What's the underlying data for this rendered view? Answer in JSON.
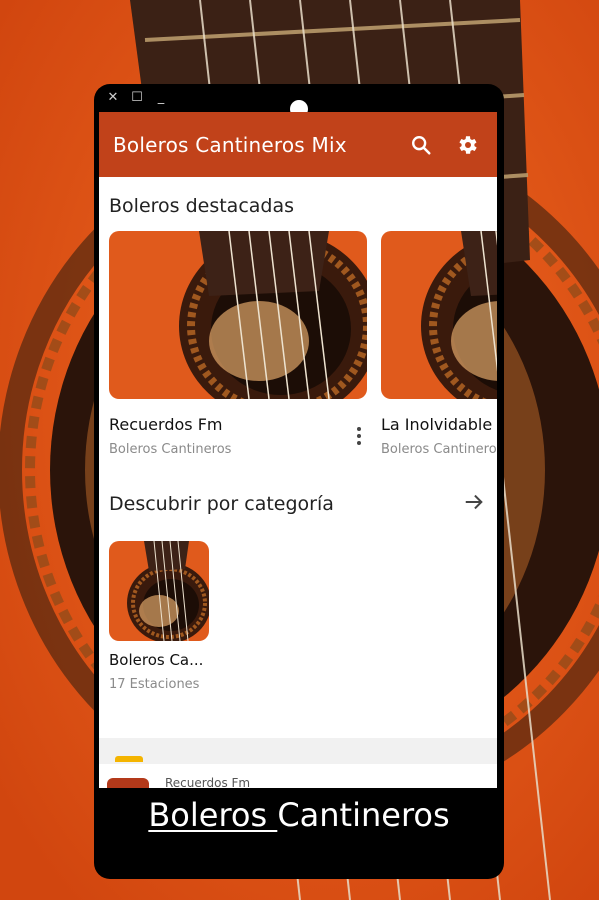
{
  "window_controls": {
    "close": "✕",
    "restore": "☐",
    "minimize": "_"
  },
  "appbar": {
    "title": "Boleros Cantineros Mix",
    "search_icon": "search-icon",
    "settings_icon": "gear-icon",
    "color": "#c1421a"
  },
  "featured": {
    "title": "Boleros destacadas",
    "items": [
      {
        "name": "Recuerdos Fm",
        "subtitle": "Boleros Cantineros"
      },
      {
        "name": "La Inolvidable",
        "subtitle": "Boleros Cantineros"
      }
    ]
  },
  "categories": {
    "title": "Descubrir por categoría",
    "arrow_icon": "arrow-right-icon",
    "items": [
      {
        "name": "Boleros Ca...",
        "subtitle": "17 Estaciones"
      }
    ]
  },
  "mini_player": {
    "title": "Recuerdos Fm"
  },
  "caption": {
    "part1": "Boleros ",
    "part2": "Cantineros"
  },
  "colors": {
    "background": "#e0531a",
    "accent": "#c1421a",
    "badge": "#f4b400"
  }
}
